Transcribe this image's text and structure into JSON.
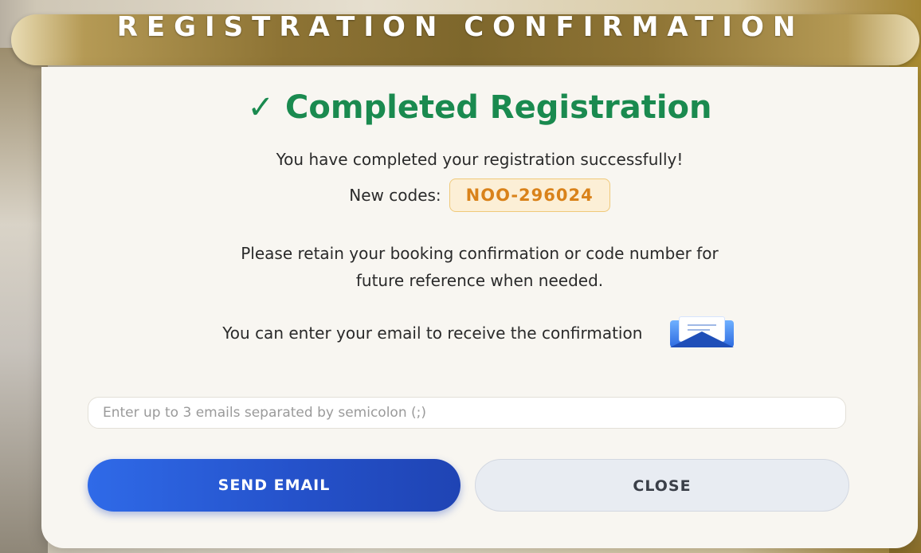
{
  "dialog": {
    "title": "REGISTRATION CONFIRMATION",
    "heading_check": "✓",
    "heading": "Completed Registration",
    "success_message": "You have completed your registration successfully!",
    "codes_label": "New codes:",
    "code_value": "NOO-296024",
    "retain_line1": "Please retain your booking confirmation or code number for",
    "retain_line2": "future reference when needed.",
    "email_prompt": "You can enter your email to receive the confirmation",
    "email_icon": "envelope-icon",
    "email_placeholder": "Enter up to 3 emails separated by semicolon (;)",
    "send_button": "SEND EMAIL",
    "close_button": "CLOSE"
  },
  "colors": {
    "accent_green": "#1a8a4f",
    "code_orange": "#d9821a",
    "primary_blue": "#2450c8",
    "title_gold": "#8d7334"
  }
}
